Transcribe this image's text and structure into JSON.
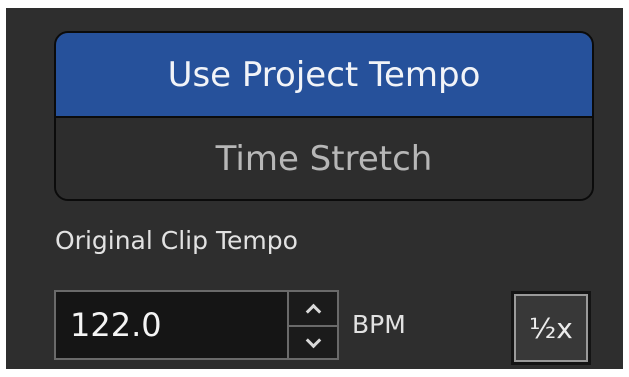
{
  "tempo_mode": {
    "options": [
      {
        "label": "Use Project Tempo",
        "selected": true
      },
      {
        "label": "Time Stretch",
        "selected": false
      }
    ]
  },
  "original_tempo": {
    "label": "Original Clip Tempo",
    "value": "122.0",
    "unit": "BPM",
    "half_button_label": "½x",
    "stepper_icons": [
      "chevron-up-icon",
      "chevron-down-icon"
    ]
  },
  "colors": {
    "panel_bg": "#2e2e2e",
    "accent_selected": "#26519b",
    "field_bg": "#151515"
  }
}
